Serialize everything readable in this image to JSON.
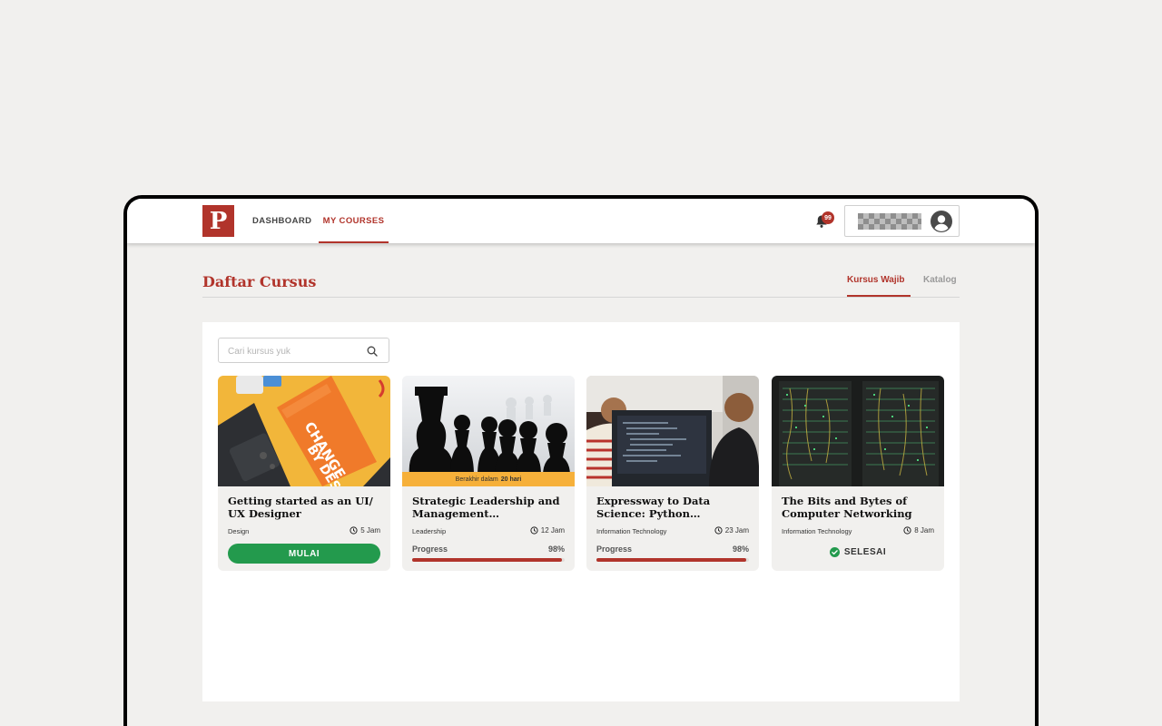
{
  "brand": {
    "logo_letter": "P",
    "color": "#b1342b"
  },
  "nav": {
    "dashboard": "DASHBOARD",
    "my_courses": "MY COURSES",
    "active": "MY COURSES"
  },
  "notifications": {
    "count": "99"
  },
  "user": {
    "avatar_icon": "user-circle-icon"
  },
  "page": {
    "title": "Daftar Cursus"
  },
  "tabs": {
    "wajib": "Kursus Wajib",
    "katalog": "Katalog",
    "active": "Kursus Wajib"
  },
  "search": {
    "placeholder": "Cari kursus yuk",
    "value": ""
  },
  "courses": [
    {
      "title": "Getting started as an UI/ UX Designer",
      "category": "Design",
      "duration": "5 Jam",
      "action": "MULAI",
      "image": "change-by-design-book"
    },
    {
      "title": "Strategic Leadership and Management Specialization",
      "category": "Leadership",
      "duration": "12 Jam",
      "deadline_prefix": "Berakhir dalam",
      "deadline_value": "20 hari",
      "progress_label": "Progress",
      "progress_text": "98%",
      "progress": 98,
      "image": "chess-pieces"
    },
    {
      "title": "Expressway to Data Science: Python Programming",
      "category": "Information Technology",
      "duration": "23 Jam",
      "progress_label": "Progress",
      "progress_text": "98%",
      "progress": 98,
      "image": "developers-coding"
    },
    {
      "title": "The Bits and Bytes of Computer Networking",
      "category": "Information Technology",
      "duration": "8 Jam",
      "status": "SELESAI",
      "image": "server-rack"
    }
  ],
  "colors": {
    "accent": "#b1342b",
    "success": "#239a4d",
    "deadline": "#f6b03a"
  }
}
